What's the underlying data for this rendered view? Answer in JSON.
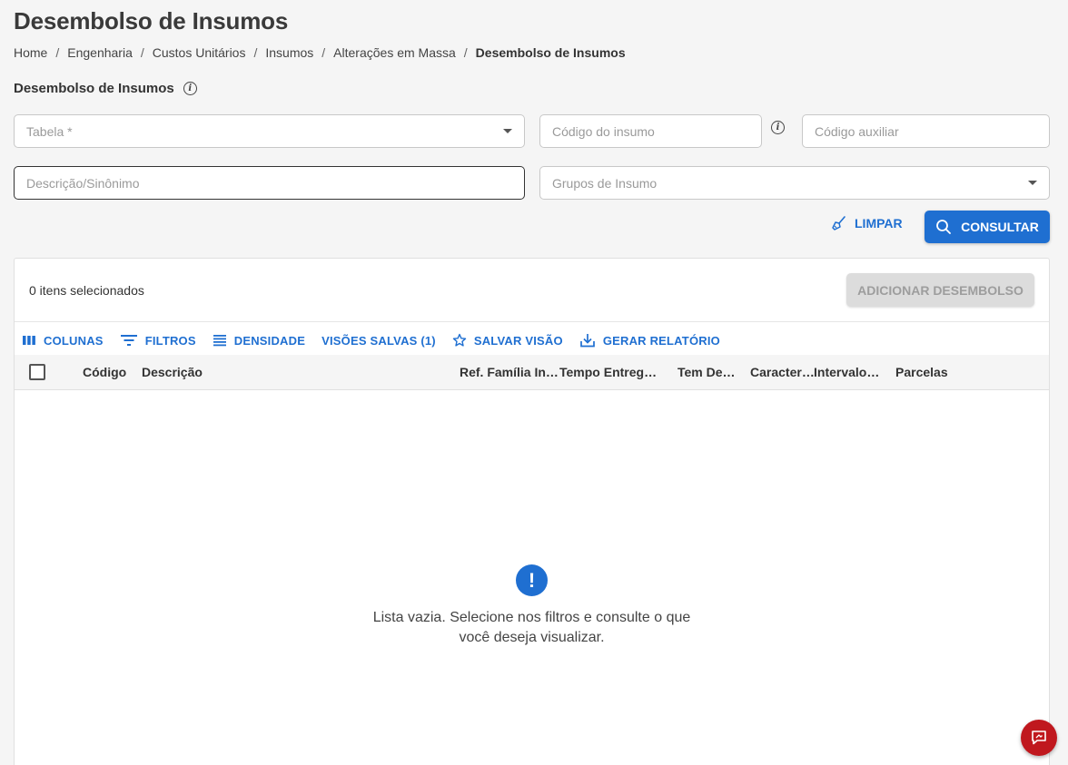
{
  "page": {
    "title": "Desembolso de Insumos"
  },
  "breadcrumb": [
    "Home",
    "Engenharia",
    "Custos Unitários",
    "Insumos",
    "Alterações em Massa",
    "Desembolso de Insumos"
  ],
  "section": {
    "title": "Desembolso de Insumos"
  },
  "filters": {
    "tabela_placeholder": "Tabela *",
    "codigo_insumo_placeholder": "Código do insumo",
    "codigo_auxiliar_placeholder": "Código auxiliar",
    "descricao_placeholder": "Descrição/Sinônimo",
    "grupos_placeholder": "Grupos de Insumo"
  },
  "actions": {
    "limpar_label": "LIMPAR",
    "consultar_label": "CONSULTAR"
  },
  "grid": {
    "selected_text": "0 itens selecionados",
    "add_button_label": "ADICIONAR DESEMBOLSO",
    "toolbar": {
      "colunas": "COLUNAS",
      "filtros": "FILTROS",
      "densidade": "DENSIDADE",
      "visoes_salvas": "VISÕES SALVAS (1)",
      "salvar_visao": "SALVAR VISÃO",
      "gerar_relatorio": "GERAR RELATÓRIO"
    },
    "columns": [
      "Código",
      "Descrição",
      "Ref. Família Ins…",
      "Tempo Entrega…",
      "Tem Des…",
      "Caracterí…",
      "Intervalo …",
      "Parcelas"
    ],
    "empty_message": "Lista vazia. Selecione nos filtros e consulte o que você deseja visualizar."
  },
  "colors": {
    "primary": "#1f6fd1",
    "fab": "#c0181e",
    "disabled_bg": "#dcdcdc"
  },
  "icons": {
    "info": "info-icon",
    "caret": "chevron-down-icon",
    "broom": "broom-icon",
    "search": "search-icon",
    "columns": "columns-icon",
    "filter": "filter-icon",
    "density": "density-icon",
    "star": "star-icon",
    "download": "download-icon",
    "alert": "alert-icon",
    "chat": "chat-icon"
  }
}
